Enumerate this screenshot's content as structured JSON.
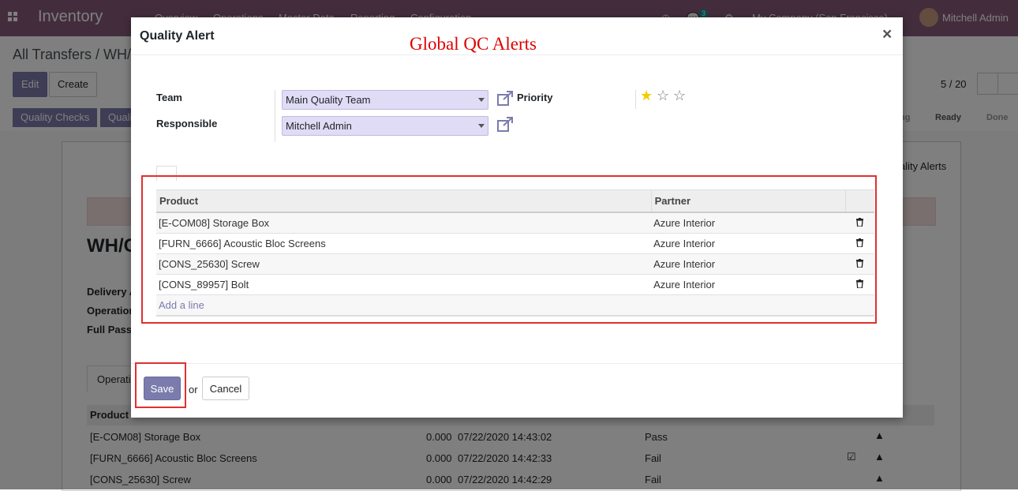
{
  "app": {
    "brand": "Inventory",
    "menu": [
      "Overview",
      "Operations",
      "Master Data",
      "Reporting",
      "Configuration"
    ],
    "chat_count": "3",
    "company": "My Company (San Francisco)",
    "user": "Mitchell Admin"
  },
  "page": {
    "breadcrumb": "All Transfers / WH/",
    "edit_label": "Edit",
    "create_label": "Create",
    "pager": "5 / 20",
    "smart_buttons": [
      "Quality Checks",
      "Quali"
    ],
    "stages": [
      "ng",
      "Ready",
      "Done"
    ],
    "tab_link": "ality Alerts",
    "record_title": "WH/C",
    "fields": [
      "Delivery A",
      "Operation",
      "Full Pass"
    ],
    "tab_operations": "Operati",
    "bg_table": {
      "header": "Product",
      "rows": [
        {
          "product": "[E-COM08] Storage Box",
          "done": "0.000",
          "date": "07/22/2020 14:43:02",
          "status": "Pass"
        },
        {
          "product": "[FURN_6666] Acoustic Bloc Screens",
          "done": "0.000",
          "date": "07/22/2020 14:42:33",
          "status": "Fail"
        },
        {
          "product": "[CONS_25630] Screw",
          "done": "0.000",
          "date": "07/22/2020 14:42:29",
          "status": "Fail"
        }
      ]
    }
  },
  "dialog": {
    "title": "Quality Alert",
    "close": "×",
    "annotation": "Global QC Alerts",
    "team_label": "Team",
    "team_value": "Main Quality Team",
    "responsible_label": "Responsible",
    "responsible_value": "Mitchell Admin",
    "priority_label": "Priority",
    "priority_stars": 1,
    "priority_max": 3,
    "columns": {
      "product": "Product",
      "partner": "Partner"
    },
    "lines": [
      {
        "product": "[E-COM08] Storage Box",
        "partner": "Azure Interior"
      },
      {
        "product": "[FURN_6666] Acoustic Bloc Screens",
        "partner": "Azure Interior"
      },
      {
        "product": "[CONS_25630] Screw",
        "partner": "Azure Interior"
      },
      {
        "product": "[CONS_89957] Bolt",
        "partner": "Azure Interior"
      }
    ],
    "add_line": "Add a line",
    "save_label": "Save",
    "or_label": "or",
    "cancel_label": "Cancel"
  },
  "colors": {
    "brand": "#875a7b",
    "primary": "#7c7bad",
    "annotation": "#e00000",
    "star": "#f3cc00"
  }
}
